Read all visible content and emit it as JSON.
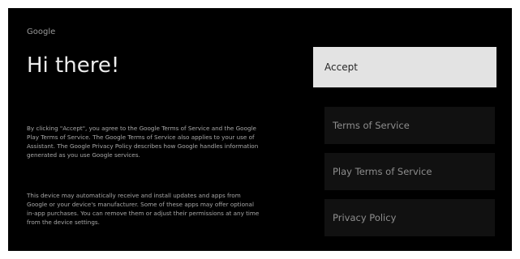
{
  "header": {
    "brand": "Google",
    "title": "Hi there!"
  },
  "body": {
    "paragraph1": "By clicking \"Accept\", you agree to the Google Terms of Service and the Google Play Terms of Service. The Google Terms of Service also applies to your use of Assistant. The Google Privacy Policy describes how Google handles information generated as you use Google services.",
    "paragraph2": "This device may automatically receive and install updates and apps from Google or your device's manufacturer. Some of these apps may offer optional in-app purchases. You can remove them or adjust their permissions at any time from the device settings."
  },
  "actions": {
    "accept": "Accept",
    "terms_of_service": "Terms of Service",
    "play_terms_of_service": "Play Terms of Service",
    "privacy_policy": "Privacy Policy"
  },
  "colors": {
    "background": "#000000",
    "focused_button": "#e3e3e3",
    "option_button": "#111111"
  }
}
